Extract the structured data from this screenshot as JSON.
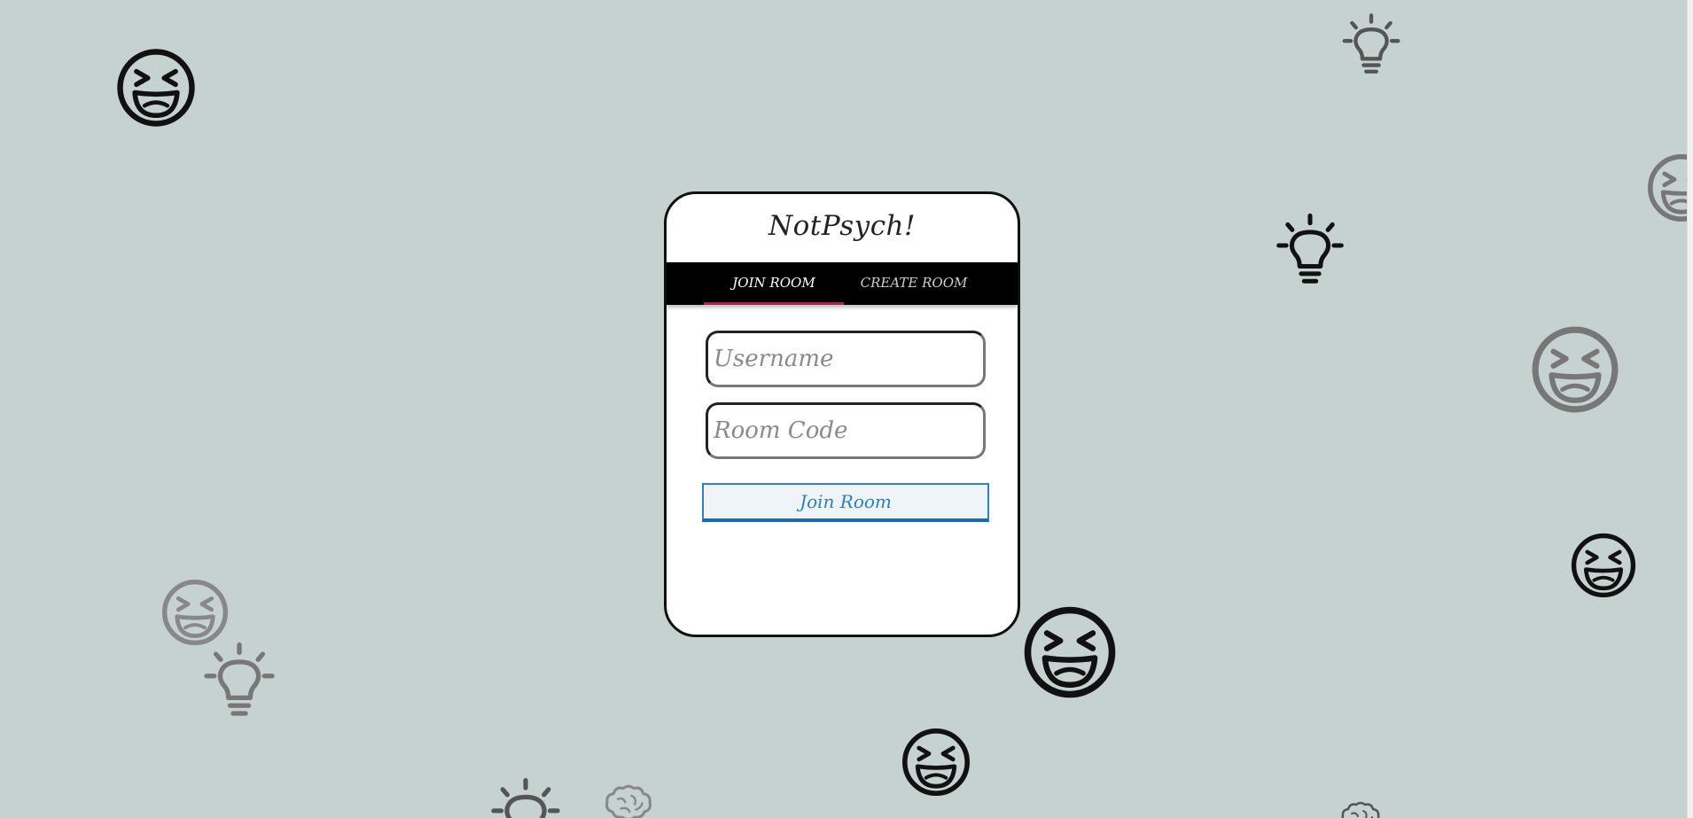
{
  "app": {
    "title": "NotPsych!"
  },
  "tabs": {
    "join_label": "JOIN ROOM",
    "create_label": "CREATE ROOM"
  },
  "form": {
    "username_placeholder": "Username",
    "username_value": "",
    "room_code_placeholder": "Room Code",
    "room_code_value": "",
    "join_button_label": "Join Room"
  },
  "decorations": {
    "icons": [
      "laughing-face-icon",
      "lightbulb-icon",
      "brain-icon"
    ]
  },
  "colors": {
    "background": "#c5d2d0",
    "tab_active_underline": "#d0104a",
    "button_accent": "#2f82c8",
    "tabbar": "#000000"
  }
}
